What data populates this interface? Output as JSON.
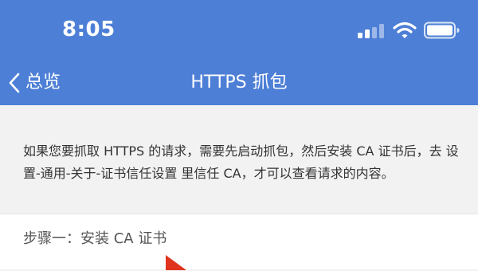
{
  "status_bar": {
    "time": "8:05",
    "signal_icon": "cellular-signal-icon",
    "wifi_icon": "wifi-icon",
    "battery_icon": "battery-icon"
  },
  "nav": {
    "back_label": "总览",
    "title": "HTTPS 抓包"
  },
  "intro_text": "如果您要抓取 HTTPS 的请求，需要先启动抓包，然后安装 CA 证书后，去 设置-通用-关于-证书信任设置 里信任 CA，才可以查看请求的内容。",
  "steps": [
    {
      "label": "步骤一：安装 CA 证书"
    }
  ],
  "colors": {
    "header": "#4d7fd6",
    "background": "#f2f2f2",
    "card": "#ffffff",
    "cursor": "#e0341e"
  }
}
